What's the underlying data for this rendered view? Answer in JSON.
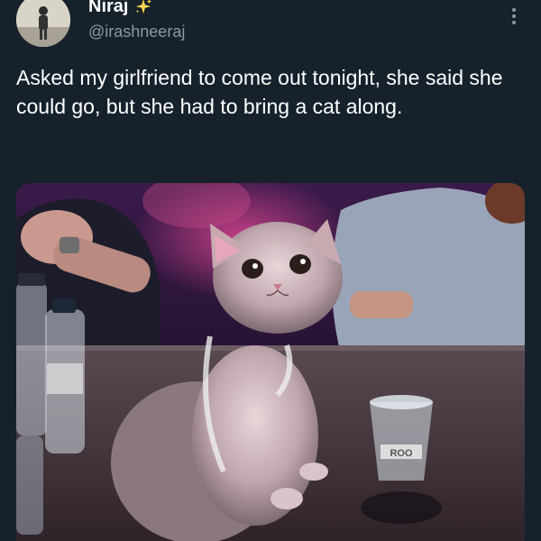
{
  "author": {
    "display_name": "Niraj",
    "handle": "@irashneeraj",
    "badge_icon": "sparkle-icon"
  },
  "tweet": {
    "text": "Asked my girlfriend to come out tonight, she said she could go, but she had to bring a cat along."
  },
  "media": {
    "alt": "Cat wearing a harness sitting on a bar counter next to water bottles and a shot glass",
    "glass_print": "ROO"
  },
  "icons": {
    "more": "more-vertical-icon",
    "avatar": "avatar"
  },
  "colors": {
    "background": "#16212c",
    "text_primary": "#ffffff",
    "text_secondary": "#8b98a5",
    "sparkle": "#ffd54a"
  }
}
